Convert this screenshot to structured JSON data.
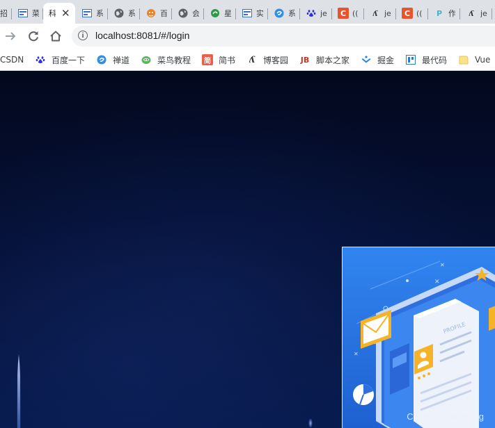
{
  "tabs": [
    {
      "label": "招",
      "icon": "generic-page-icon",
      "active": false
    },
    {
      "label": "菜",
      "icon": "generic-page-icon",
      "active": false
    },
    {
      "label": "科",
      "icon": "generic-page-icon",
      "active": true
    },
    {
      "label": "系",
      "icon": "generic-page-icon",
      "active": false
    },
    {
      "label": "系",
      "icon": "globe-icon",
      "active": false
    },
    {
      "label": "百",
      "icon": "fox-icon",
      "active": false
    },
    {
      "label": "会",
      "icon": "globe-icon",
      "active": false
    },
    {
      "label": "星",
      "icon": "green-circle-icon",
      "active": false
    },
    {
      "label": "实",
      "icon": "generic-page-icon",
      "active": false
    },
    {
      "label": "系",
      "icon": "swirl-icon",
      "active": false
    },
    {
      "label": "je",
      "icon": "baidu-paw-icon",
      "active": false
    },
    {
      "label": "((",
      "icon": "csdn-c-icon",
      "active": false
    },
    {
      "label": "je",
      "icon": "script-icon",
      "active": false
    },
    {
      "label": "((",
      "icon": "csdn-c-icon",
      "active": false
    },
    {
      "label": "作",
      "icon": "p-icon",
      "active": false
    },
    {
      "label": "je",
      "icon": "script-icon",
      "active": false
    }
  ],
  "toolbar": {
    "url": "localhost:8081/#/login"
  },
  "bookmarks": [
    {
      "label": "CSDN",
      "icon": ""
    },
    {
      "label": "百度一下",
      "icon": "baidu-paw-icon"
    },
    {
      "label": "禅道",
      "icon": "swirl-icon"
    },
    {
      "label": "菜鸟教程",
      "icon": "runoob-icon"
    },
    {
      "label": "简书",
      "icon": "jianshu-icon"
    },
    {
      "label": "博客园",
      "icon": "script-icon"
    },
    {
      "label": "脚本之家",
      "icon": "jb51-icon"
    },
    {
      "label": "掘金",
      "icon": "juejin-icon"
    },
    {
      "label": "最代码",
      "icon": "zuidaima-icon"
    },
    {
      "label": "Vue",
      "icon": "folder-icon"
    }
  ],
  "page": {
    "illustration_text": "PROFILE",
    "watermark": "CSDN @Sun   Peng"
  },
  "colors": {
    "tab_strip": "#dee1e6",
    "page_bg_top": "#03081d",
    "page_bg_bottom": "#071a4d",
    "illustration_blue": "#2a78e6",
    "accent_yellow": "#f5b427"
  }
}
